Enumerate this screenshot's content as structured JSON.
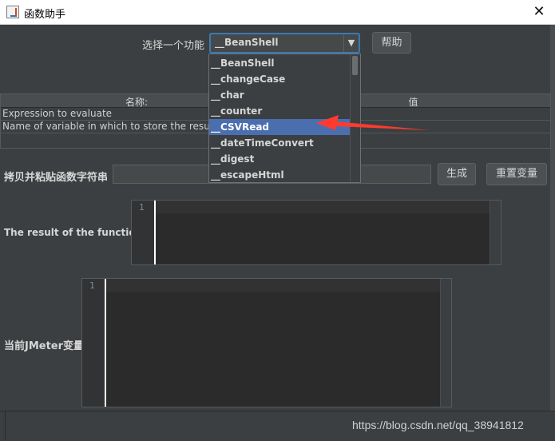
{
  "window": {
    "title": "函数助手",
    "close_glyph": "✕"
  },
  "selector": {
    "label": "选择一个功能",
    "selected_value": "__BeanShell",
    "help_button": "帮助",
    "arrow_glyph": "▼"
  },
  "dropdown": {
    "items": [
      "__BeanShell",
      "__changeCase",
      "__char",
      "__counter",
      "__CSVRead",
      "__dateTimeConvert",
      "__digest",
      "__escapeHtml"
    ],
    "highlighted": "__CSVRead"
  },
  "params_table": {
    "columns": [
      "名称:",
      "值"
    ],
    "rows": [
      [
        "Expression to evaluate",
        ""
      ],
      [
        "Name of variable in which to store the result (optional)",
        ""
      ]
    ]
  },
  "copy_row": {
    "label": "拷贝并粘贴函数字符串",
    "value": "",
    "generate_button": "生成",
    "reset_button": "重置变量"
  },
  "result": {
    "label": "The result of the function is",
    "line_number": "1"
  },
  "variables": {
    "label": "当前JMeter变量",
    "line_number": "1"
  },
  "watermark": "https://blog.csdn.net/qq_38941812",
  "colors": {
    "accent": "#4b6eaf",
    "annotation_arrow": "#ff3b30",
    "background": "#3c3f41"
  },
  "icons": {
    "app": "jmeter-app-icon",
    "close": "close-icon",
    "dropdown_arrow": "chevron-down-icon"
  }
}
